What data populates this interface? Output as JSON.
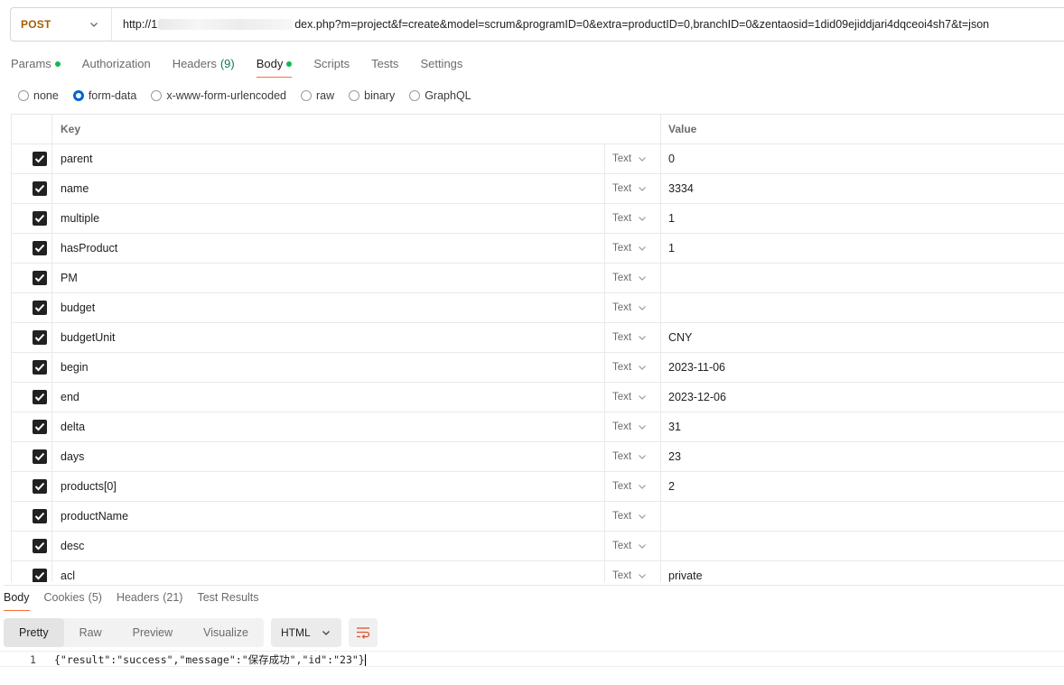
{
  "request": {
    "method": "POST",
    "url_prefix": "http://1",
    "url_suffix": "dex.php?m=project&f=create&model=scrum&programID=0&extra=productID=0,branchID=0&zentaosid=1did09ejiddjari4dqceoi4sh7&t=json"
  },
  "tabs": [
    {
      "label": "Params",
      "dot": true,
      "count": ""
    },
    {
      "label": "Authorization",
      "dot": false,
      "count": ""
    },
    {
      "label": "Headers",
      "dot": false,
      "count": "(9)"
    },
    {
      "label": "Body",
      "dot": true,
      "count": "",
      "active": true
    },
    {
      "label": "Scripts",
      "dot": false,
      "count": ""
    },
    {
      "label": "Tests",
      "dot": false,
      "count": ""
    },
    {
      "label": "Settings",
      "dot": false,
      "count": ""
    }
  ],
  "body_types": [
    {
      "label": "none",
      "selected": false
    },
    {
      "label": "form-data",
      "selected": true
    },
    {
      "label": "x-www-form-urlencoded",
      "selected": false
    },
    {
      "label": "raw",
      "selected": false
    },
    {
      "label": "binary",
      "selected": false
    },
    {
      "label": "GraphQL",
      "selected": false
    }
  ],
  "table": {
    "key_header": "Key",
    "value_header": "Value",
    "type_label": "Text",
    "rows": [
      {
        "key": "parent",
        "value": "0"
      },
      {
        "key": "name",
        "value": "3334"
      },
      {
        "key": "multiple",
        "value": "1"
      },
      {
        "key": "hasProduct",
        "value": "1"
      },
      {
        "key": "PM",
        "value": ""
      },
      {
        "key": "budget",
        "value": ""
      },
      {
        "key": "budgetUnit",
        "value": "CNY"
      },
      {
        "key": "begin",
        "value": "2023-11-06"
      },
      {
        "key": "end",
        "value": "2023-12-06"
      },
      {
        "key": "delta",
        "value": "31"
      },
      {
        "key": "days",
        "value": "23"
      },
      {
        "key": "products[0]",
        "value": "2"
      },
      {
        "key": "productName",
        "value": ""
      },
      {
        "key": "desc",
        "value": ""
      },
      {
        "key": "acl",
        "value": "private"
      }
    ]
  },
  "response": {
    "tabs": [
      {
        "label": "Body",
        "count": "",
        "active": true
      },
      {
        "label": "Cookies",
        "count": "(5)"
      },
      {
        "label": "Headers",
        "count": "(21)"
      },
      {
        "label": "Test Results",
        "count": ""
      }
    ],
    "views": [
      {
        "label": "Pretty",
        "active": true
      },
      {
        "label": "Raw",
        "active": false
      },
      {
        "label": "Preview",
        "active": false
      },
      {
        "label": "Visualize",
        "active": false
      }
    ],
    "format": "HTML",
    "line_number": "1",
    "body": "{\"result\":\"success\",\"message\":\"保存成功\",\"id\":\"23\"}"
  },
  "colors": {
    "method": "#a35f00",
    "accent_tab": "#ff6c37",
    "dot_green": "#0cbb52",
    "radio_blue": "#0265d2"
  }
}
